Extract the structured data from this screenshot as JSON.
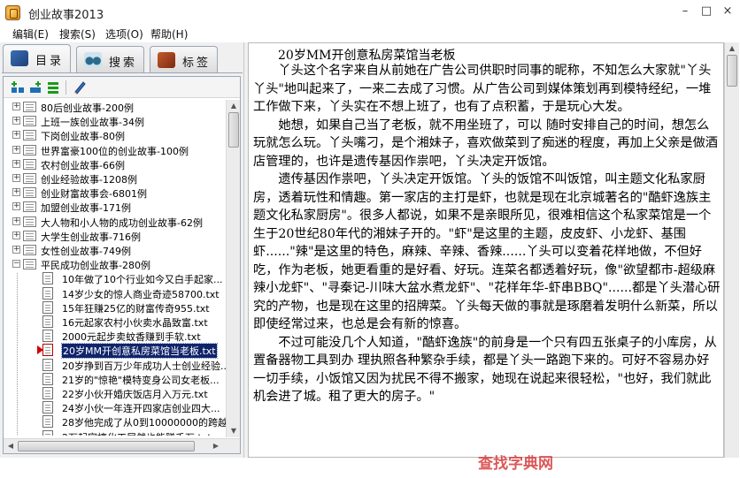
{
  "window": {
    "title": "创业故事2013",
    "controls": [
      "–",
      "□",
      "×"
    ]
  },
  "menu": [
    "编辑(E)",
    "搜索(S)",
    "选项(O)",
    "帮助(H)"
  ],
  "tabs": [
    {
      "label": "目录",
      "icon": "book-icon",
      "active": true
    },
    {
      "label": "搜索",
      "icon": "binoculars-icon",
      "active": false
    },
    {
      "label": "标签",
      "icon": "bookmark-icon",
      "active": false
    }
  ],
  "toolbar": [
    "add-category-icon",
    "add-item-icon",
    "list-icon",
    "edit-pen-icon"
  ],
  "tree": {
    "categories": [
      "80后创业故事-200例",
      "上班一族创业故事-34例",
      "下岗创业故事-80例",
      "世界富豪100位的创业故事-100例",
      "农村创业故事-66例",
      "创业经验故事-1208例",
      "创业财富故事会-6801例",
      "加盟创业故事-171例",
      "大人物和小人物的成功创业故事-62例",
      "大学生创业故事-716例",
      "女性创业故事-749例",
      "平民成功创业故事-280例"
    ],
    "children": [
      "10年做了10个行业如今又白手起家...",
      "14岁少女的惊人商业奇迹58700.txt",
      "15年狂赚25亿的财富传奇955.txt",
      "16元起家农村小伙卖水晶致富.txt",
      "2000元起步卖蚊香赚到手软.txt",
      "20岁MM开创意私房菜馆当老板.txt",
      "20岁挣到百万少年成功人士创业经验...",
      "21岁的\"惊艳\"模特变身公司女老板...",
      "22岁小伙开婚庆饭店月入万元.txt",
      "24岁小伙一年连开四家店创业四大...",
      "28岁他完成了从0到10000000的跨越...",
      "2万起家搞化工居然也能赚千万.txt"
    ],
    "selected_index": 5
  },
  "reader": {
    "title": "20岁MM开创意私房菜馆当老板",
    "paragraphs": [
      "丫头这个名字来自从前她在广告公司供职时同事的昵称，不知怎么大家就\"丫头丫头\"地叫起来了，一来二去成了习惯。从广告公司到媒体策划再到模特经纪，一堆工作做下来，丫头实在不想上班了，也有了点积蓄，于是玩心大发。",
      "她想，如果自己当了老板，就不用坐班了，可以 随时安排自己的时间，想怎么玩就怎么玩。丫头嘴刁，是个湘妹子，喜欢做菜到了痴迷的程度，再加上父亲是做酒店管理的，也许是遗传基因作祟吧，丫头决定开饭馆。",
      "遗传基因作祟吧，丫头决定开饭馆。丫头的饭馆不叫饭馆，叫主题文化私家厨房，透着玩性和情趣。第一家店的主打是虾，也就是现在北京城著名的\"酷虾逸族主题文化私家厨房\"。很多人都说，如果不是亲眼所见，很难相信这个私家菜馆是一个生于20世纪80年代的湘妹子开的。\"虾\"是这里的主题，皮皮虾、小龙虾、基围虾......\"辣\"是这里的特色，麻辣、辛辣、香辣......丫头可以变着花样地做，不但好吃，作为老板，她更看重的是好看、好玩。连菜名都透着好玩，像\"欲望都市-超级麻辣小龙虾\"、\"寻秦记-川味大盆水煮龙虾\"、\"花样年华-虾串BBQ\"......都是丫头潜心研究的产物，也是现在这里的招牌菜。丫头每天做的事就是琢磨着发明什么新菜，所以即使经常过来，也总是会有新的惊喜。",
      "不过可能没几个人知道，\"酷虾逸族\"的前身是一个只有四五张桌子的小库房，从置备器物工具到办 理执照各种繁杂手续，都是丫头一路跑下来的。可好不容易办好一切手续，小饭馆又因为扰民不得不搬家，她现在说起来很轻松，\"也好，我们就此机会进了城。租了更大的房子。\""
    ]
  },
  "watermark": "查找字典网",
  "colors": {
    "selection_bg": "#10246a",
    "selection_text": "#ffffff",
    "arrow_marker": "#d20000",
    "watermark": "#d63b3b"
  }
}
